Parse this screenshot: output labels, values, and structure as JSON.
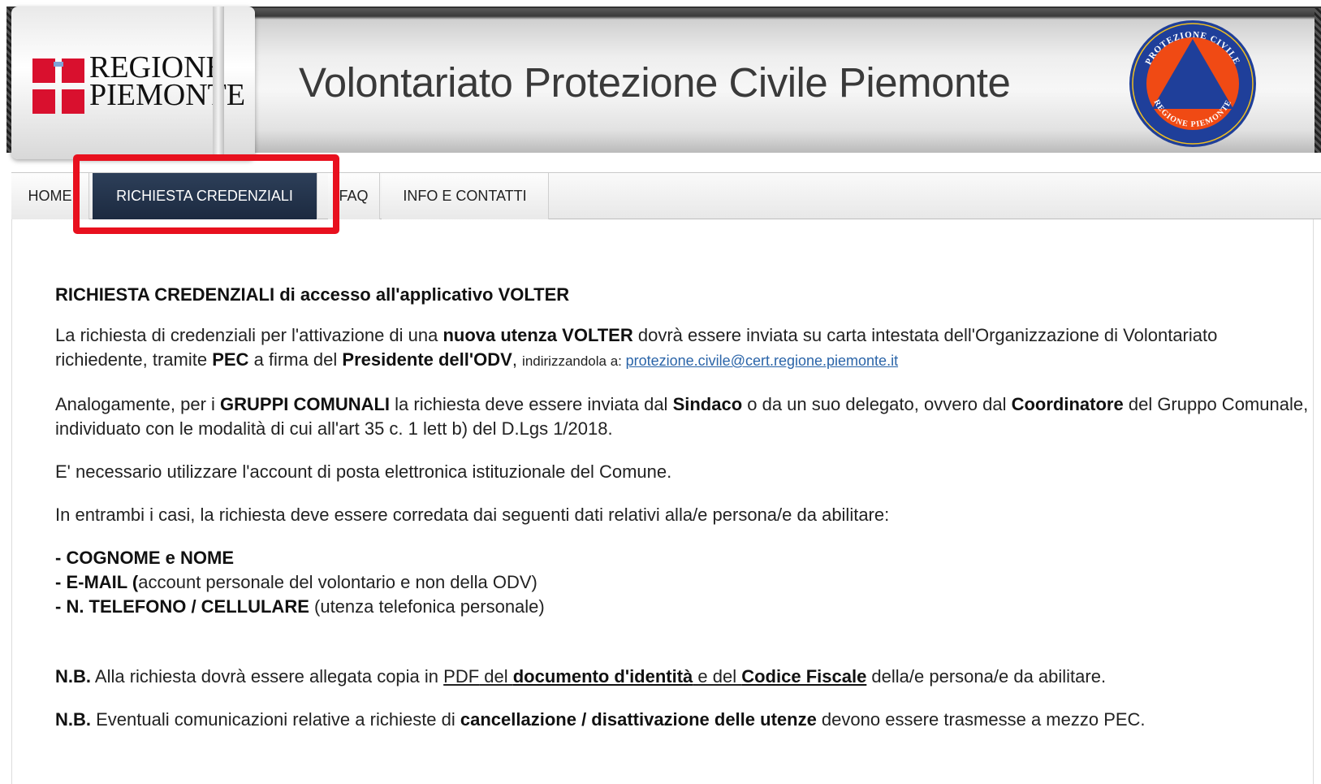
{
  "header": {
    "logo_line1": "REGIONE",
    "logo_line2": "PIEMONTE",
    "site_title": "Volontariato Protezione Civile Piemonte",
    "seal_top_text": "PROTEZIONE CIVILE",
    "seal_bottom_text": "REGIONE PIEMONTE"
  },
  "nav": {
    "items": [
      {
        "label": "HOME"
      },
      {
        "label": "RICHIESTA CREDENZIALI",
        "active": true
      },
      {
        "label": "FAQ"
      },
      {
        "label": "INFO E CONTATTI"
      }
    ]
  },
  "content": {
    "heading": "RICHIESTA CREDENZIALI di accesso all'applicativo VOLTER",
    "p1": {
      "t1": "La richiesta di credenziali per l'attivazione di una ",
      "b1": "nuova utenza VOLTER",
      "t2": " dovrà essere inviata su carta intestata dell'Organizzazione di Volontariato richiedente, tramite ",
      "b2": "PEC",
      "t3": " a firma del ",
      "b3": "Presidente dell'ODV",
      "t4": ", ",
      "small": "indirizzandola a: ",
      "email": "protezione.civile@cert.regione.piemonte.it"
    },
    "p2": {
      "t1": "Analogamente, per i ",
      "b1": "GRUPPI COMUNALI",
      "t2": " la richiesta deve essere inviata dal ",
      "b2": "Sindaco",
      "t3": " o da un suo delegato, ovvero dal ",
      "b3": "Coordinatore",
      "t4": " del Gruppo Comunale, individuato con le modalità di cui all'art 35 c. 1 lett b) del D.Lgs 1/2018."
    },
    "p3": "E' necessario utilizzare l'account di posta elettronica istituzionale del Comune.",
    "p4": "In entrambi i casi, la richiesta deve essere corredata dai seguenti dati relativi alla/e persona/e da abilitare:",
    "list": {
      "i1_bold": "- COGNOME e NOME",
      "i2_bold": "- E-MAIL (",
      "i2_text": "account personale del volontario e non della ODV)",
      "i3_bold": "- N. TELEFONO / CELLULARE",
      "i3_text": " (utenza telefonica personale)"
    },
    "nb1": {
      "b": "N.B.",
      "t1": " Alla richiesta dovrà essere allegata copia in ",
      "u1": "PDF",
      "u2": " del ",
      "ub1": "documento d'identità",
      "u3": " e del ",
      "ub2": "Codice Fiscale",
      "t2": " della/e persona/e da abilitare."
    },
    "nb2": {
      "b": "N.B.",
      "t1": " Eventuali comunicazioni relative a richieste di ",
      "b2": "cancellazione / disattivazione delle utenze",
      "t2": " devono essere trasmesse a mezzo PEC."
    }
  },
  "colors": {
    "nav_active_bg": "#1c2a40",
    "highlight": "#e8101e",
    "link": "#2a64a8",
    "seal_orange": "#f04a14",
    "seal_blue": "#1f3f9a"
  }
}
